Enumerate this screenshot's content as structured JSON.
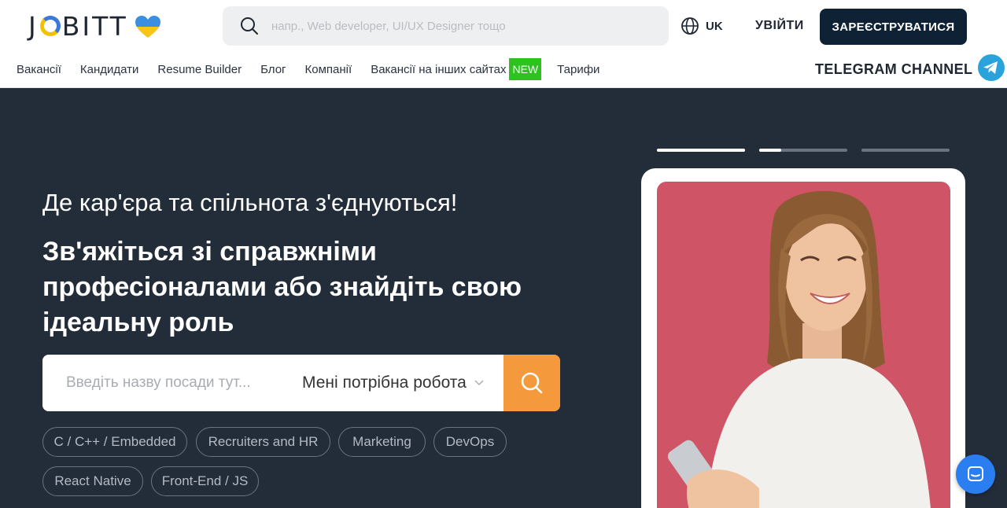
{
  "header": {
    "logo": "JOBITT",
    "search_placeholder": "напр., Web developer, UI/UX Designer тощо",
    "language": "UK",
    "login_label": "УВІЙТИ",
    "register_label": "ЗАРЕЄСТРУВАТИСЯ",
    "telegram_label": "TELEGRAM CHANNEL"
  },
  "nav": {
    "items": [
      "Вакансії",
      "Кандидати",
      "Resume Builder",
      "Блог",
      "Компанії",
      "Вакансії на інших сайтах",
      "Тарифи"
    ],
    "new_badge": "NEW"
  },
  "hero": {
    "subtitle": "Де кар'єра та спільнота з'єднуються!",
    "headline": "Зв'яжіться зі справжніми професіоналами або знайдіть свою ідеальну роль",
    "search_placeholder": "Введіть назву посади тут...",
    "search_mode": "Мені потрібна робота",
    "tags": [
      "C / C++ / Embedded",
      "Recruiters and HR",
      "Marketing",
      "DevOps",
      "React Native",
      "Front-End / JS"
    ],
    "slider_progress": [
      1.0,
      0.25,
      0.0
    ]
  },
  "colors": {
    "brand_dark": "#0f2235",
    "hero_bg": "#232d3a",
    "accent_orange": "#f59a3c",
    "new_badge_green": "#2ec21f",
    "telegram_blue": "#2aa3dc",
    "chat_blue": "#2a7ef0",
    "photo_bg": "#cf5466"
  },
  "icons": {
    "search": "search-icon",
    "globe": "globe-icon",
    "telegram": "telegram-icon",
    "chat": "chat-icon",
    "heart": "ukraine-heart-icon"
  }
}
